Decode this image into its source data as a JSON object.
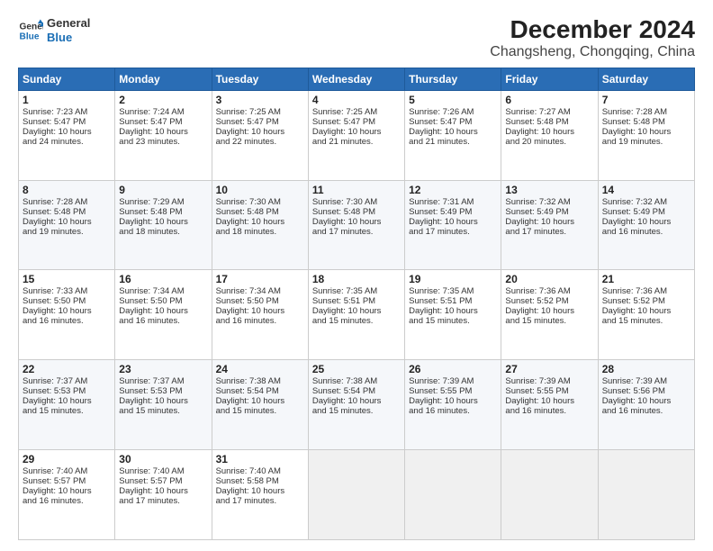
{
  "logo": {
    "line1": "General",
    "line2": "Blue"
  },
  "title": "December 2024",
  "subtitle": "Changsheng, Chongqing, China",
  "weekdays": [
    "Sunday",
    "Monday",
    "Tuesday",
    "Wednesday",
    "Thursday",
    "Friday",
    "Saturday"
  ],
  "weeks": [
    [
      {
        "day": "1",
        "lines": [
          "Sunrise: 7:23 AM",
          "Sunset: 5:47 PM",
          "Daylight: 10 hours",
          "and 24 minutes."
        ]
      },
      {
        "day": "2",
        "lines": [
          "Sunrise: 7:24 AM",
          "Sunset: 5:47 PM",
          "Daylight: 10 hours",
          "and 23 minutes."
        ]
      },
      {
        "day": "3",
        "lines": [
          "Sunrise: 7:25 AM",
          "Sunset: 5:47 PM",
          "Daylight: 10 hours",
          "and 22 minutes."
        ]
      },
      {
        "day": "4",
        "lines": [
          "Sunrise: 7:25 AM",
          "Sunset: 5:47 PM",
          "Daylight: 10 hours",
          "and 21 minutes."
        ]
      },
      {
        "day": "5",
        "lines": [
          "Sunrise: 7:26 AM",
          "Sunset: 5:47 PM",
          "Daylight: 10 hours",
          "and 21 minutes."
        ]
      },
      {
        "day": "6",
        "lines": [
          "Sunrise: 7:27 AM",
          "Sunset: 5:48 PM",
          "Daylight: 10 hours",
          "and 20 minutes."
        ]
      },
      {
        "day": "7",
        "lines": [
          "Sunrise: 7:28 AM",
          "Sunset: 5:48 PM",
          "Daylight: 10 hours",
          "and 19 minutes."
        ]
      }
    ],
    [
      {
        "day": "8",
        "lines": [
          "Sunrise: 7:28 AM",
          "Sunset: 5:48 PM",
          "Daylight: 10 hours",
          "and 19 minutes."
        ]
      },
      {
        "day": "9",
        "lines": [
          "Sunrise: 7:29 AM",
          "Sunset: 5:48 PM",
          "Daylight: 10 hours",
          "and 18 minutes."
        ]
      },
      {
        "day": "10",
        "lines": [
          "Sunrise: 7:30 AM",
          "Sunset: 5:48 PM",
          "Daylight: 10 hours",
          "and 18 minutes."
        ]
      },
      {
        "day": "11",
        "lines": [
          "Sunrise: 7:30 AM",
          "Sunset: 5:48 PM",
          "Daylight: 10 hours",
          "and 17 minutes."
        ]
      },
      {
        "day": "12",
        "lines": [
          "Sunrise: 7:31 AM",
          "Sunset: 5:49 PM",
          "Daylight: 10 hours",
          "and 17 minutes."
        ]
      },
      {
        "day": "13",
        "lines": [
          "Sunrise: 7:32 AM",
          "Sunset: 5:49 PM",
          "Daylight: 10 hours",
          "and 17 minutes."
        ]
      },
      {
        "day": "14",
        "lines": [
          "Sunrise: 7:32 AM",
          "Sunset: 5:49 PM",
          "Daylight: 10 hours",
          "and 16 minutes."
        ]
      }
    ],
    [
      {
        "day": "15",
        "lines": [
          "Sunrise: 7:33 AM",
          "Sunset: 5:50 PM",
          "Daylight: 10 hours",
          "and 16 minutes."
        ]
      },
      {
        "day": "16",
        "lines": [
          "Sunrise: 7:34 AM",
          "Sunset: 5:50 PM",
          "Daylight: 10 hours",
          "and 16 minutes."
        ]
      },
      {
        "day": "17",
        "lines": [
          "Sunrise: 7:34 AM",
          "Sunset: 5:50 PM",
          "Daylight: 10 hours",
          "and 16 minutes."
        ]
      },
      {
        "day": "18",
        "lines": [
          "Sunrise: 7:35 AM",
          "Sunset: 5:51 PM",
          "Daylight: 10 hours",
          "and 15 minutes."
        ]
      },
      {
        "day": "19",
        "lines": [
          "Sunrise: 7:35 AM",
          "Sunset: 5:51 PM",
          "Daylight: 10 hours",
          "and 15 minutes."
        ]
      },
      {
        "day": "20",
        "lines": [
          "Sunrise: 7:36 AM",
          "Sunset: 5:52 PM",
          "Daylight: 10 hours",
          "and 15 minutes."
        ]
      },
      {
        "day": "21",
        "lines": [
          "Sunrise: 7:36 AM",
          "Sunset: 5:52 PM",
          "Daylight: 10 hours",
          "and 15 minutes."
        ]
      }
    ],
    [
      {
        "day": "22",
        "lines": [
          "Sunrise: 7:37 AM",
          "Sunset: 5:53 PM",
          "Daylight: 10 hours",
          "and 15 minutes."
        ]
      },
      {
        "day": "23",
        "lines": [
          "Sunrise: 7:37 AM",
          "Sunset: 5:53 PM",
          "Daylight: 10 hours",
          "and 15 minutes."
        ]
      },
      {
        "day": "24",
        "lines": [
          "Sunrise: 7:38 AM",
          "Sunset: 5:54 PM",
          "Daylight: 10 hours",
          "and 15 minutes."
        ]
      },
      {
        "day": "25",
        "lines": [
          "Sunrise: 7:38 AM",
          "Sunset: 5:54 PM",
          "Daylight: 10 hours",
          "and 15 minutes."
        ]
      },
      {
        "day": "26",
        "lines": [
          "Sunrise: 7:39 AM",
          "Sunset: 5:55 PM",
          "Daylight: 10 hours",
          "and 16 minutes."
        ]
      },
      {
        "day": "27",
        "lines": [
          "Sunrise: 7:39 AM",
          "Sunset: 5:55 PM",
          "Daylight: 10 hours",
          "and 16 minutes."
        ]
      },
      {
        "day": "28",
        "lines": [
          "Sunrise: 7:39 AM",
          "Sunset: 5:56 PM",
          "Daylight: 10 hours",
          "and 16 minutes."
        ]
      }
    ],
    [
      {
        "day": "29",
        "lines": [
          "Sunrise: 7:40 AM",
          "Sunset: 5:57 PM",
          "Daylight: 10 hours",
          "and 16 minutes."
        ]
      },
      {
        "day": "30",
        "lines": [
          "Sunrise: 7:40 AM",
          "Sunset: 5:57 PM",
          "Daylight: 10 hours",
          "and 17 minutes."
        ]
      },
      {
        "day": "31",
        "lines": [
          "Sunrise: 7:40 AM",
          "Sunset: 5:58 PM",
          "Daylight: 10 hours",
          "and 17 minutes."
        ]
      },
      null,
      null,
      null,
      null
    ]
  ]
}
